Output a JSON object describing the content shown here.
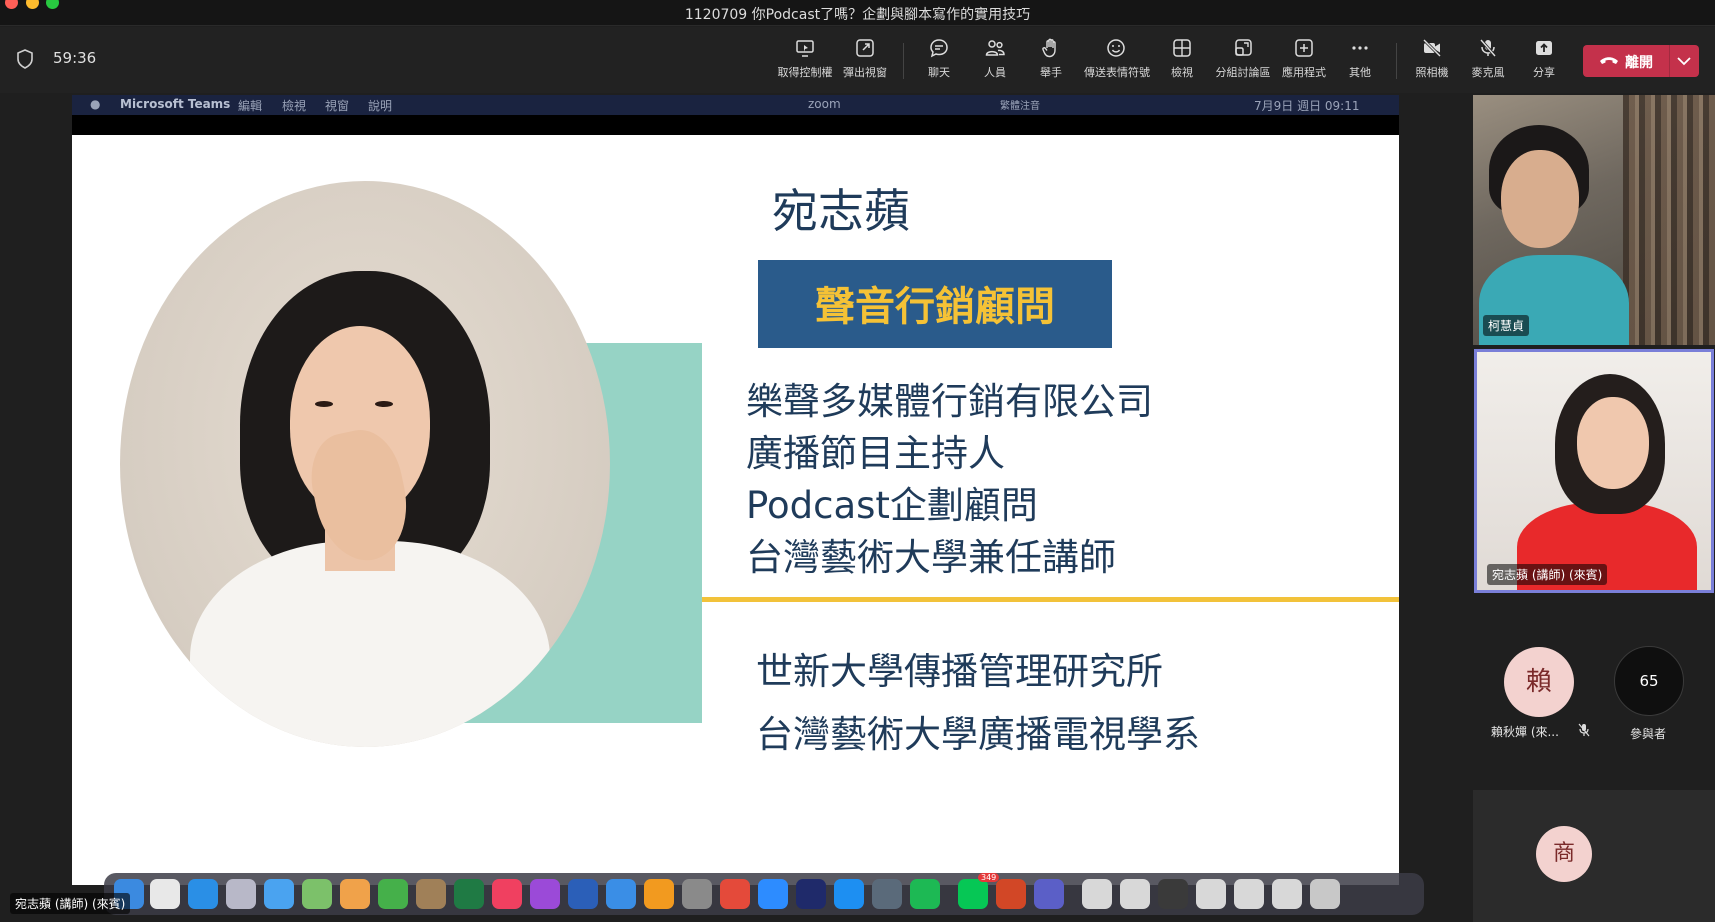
{
  "window": {
    "title": "1120709 你Podcast了嗎？企劃與腳本寫作的實用技巧"
  },
  "toolbar": {
    "timer": "59:36",
    "buttons": [
      {
        "label": "取得控制權",
        "icon": "take-control-icon"
      },
      {
        "label": "彈出視窗",
        "icon": "pop-out-icon"
      },
      {
        "label": "聊天",
        "icon": "chat-icon"
      },
      {
        "label": "人員",
        "icon": "people-icon"
      },
      {
        "label": "舉手",
        "icon": "raise-hand-icon"
      },
      {
        "label": "傳送表情符號",
        "icon": "emoji-icon"
      },
      {
        "label": "檢視",
        "icon": "view-icon"
      },
      {
        "label": "分組討論區",
        "icon": "breakout-rooms-icon"
      },
      {
        "label": "應用程式",
        "icon": "apps-icon"
      },
      {
        "label": "其他",
        "icon": "more-icon"
      },
      {
        "label": "照相機",
        "icon": "camera-off-icon"
      },
      {
        "label": "麥克風",
        "icon": "mic-off-icon"
      },
      {
        "label": "分享",
        "icon": "share-icon"
      }
    ],
    "leave_label": "離開",
    "leave_color": "#c4314b"
  },
  "mac_menubar": {
    "app": "Microsoft Teams",
    "menus": [
      "編輯",
      "檢視",
      "視窗",
      "說明"
    ],
    "zoom": "zoom",
    "input_method": "繁體注音",
    "clock": "7月9日 週日 09:11"
  },
  "slide": {
    "name": "宛志蘋",
    "badge": "聲音行銷顧問",
    "credentials": [
      "樂聲多媒體行銷有限公司",
      "廣播節目主持人",
      "Podcast企劃顧問",
      "台灣藝術大學兼任講師"
    ],
    "education": [
      "世新大學傳播管理研究所",
      "台灣藝術大學廣播電視學系"
    ],
    "colors": {
      "text": "#1f3b5a",
      "badge_bg": "#2a5b8b",
      "badge_text": "#f5c236",
      "accent_line": "#f2c23a",
      "teal": "#96d3c5"
    }
  },
  "dock": {
    "badge_count": "349"
  },
  "participants": {
    "video1_name": "柯慧貞",
    "video2_name": "宛志蘋 (講師) (來賓)",
    "lai_initial": "賴",
    "lai_name": "賴秋嬋 (來...",
    "count": "65",
    "count_label": "參與者",
    "shang_initial": "商"
  },
  "self_view": {
    "name": "宛志蘋 (講師) (來賓)"
  }
}
